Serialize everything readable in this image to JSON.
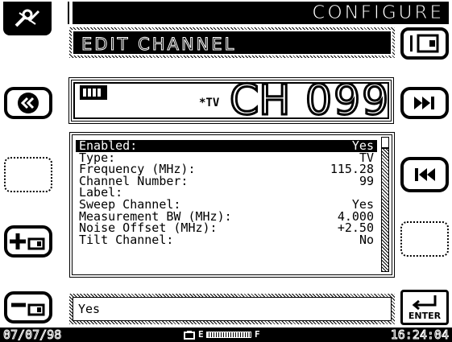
{
  "header": {
    "title": "CONFIGURE",
    "subtitle": "EDIT CHANNEL"
  },
  "channel_display": {
    "type_tag": "*TV",
    "prefix": "CH",
    "number": "099"
  },
  "settings": {
    "rows": [
      {
        "label": "Enabled:",
        "value": "Yes"
      },
      {
        "label": "Type:",
        "value": "TV"
      },
      {
        "label": "Frequency (MHz):",
        "value": "115.28"
      },
      {
        "label": "Channel Number:",
        "value": "99"
      },
      {
        "label": "Label:",
        "value": ""
      },
      {
        "label": "Sweep Channel:",
        "value": "Yes"
      },
      {
        "label": "Measurement BW (MHz):",
        "value": "4.000"
      },
      {
        "label": "Noise Offset (MHz):",
        "value": "+2.50"
      },
      {
        "label": "Tilt Channel:",
        "value": "No"
      }
    ],
    "selected_index": 0
  },
  "edit_field": {
    "value": "Yes"
  },
  "buttons": {
    "enter_label": "ENTER"
  },
  "status_bar": {
    "date": "07/07/98",
    "time": "16:24:04",
    "battery_empty": "E",
    "battery_full": "F"
  }
}
